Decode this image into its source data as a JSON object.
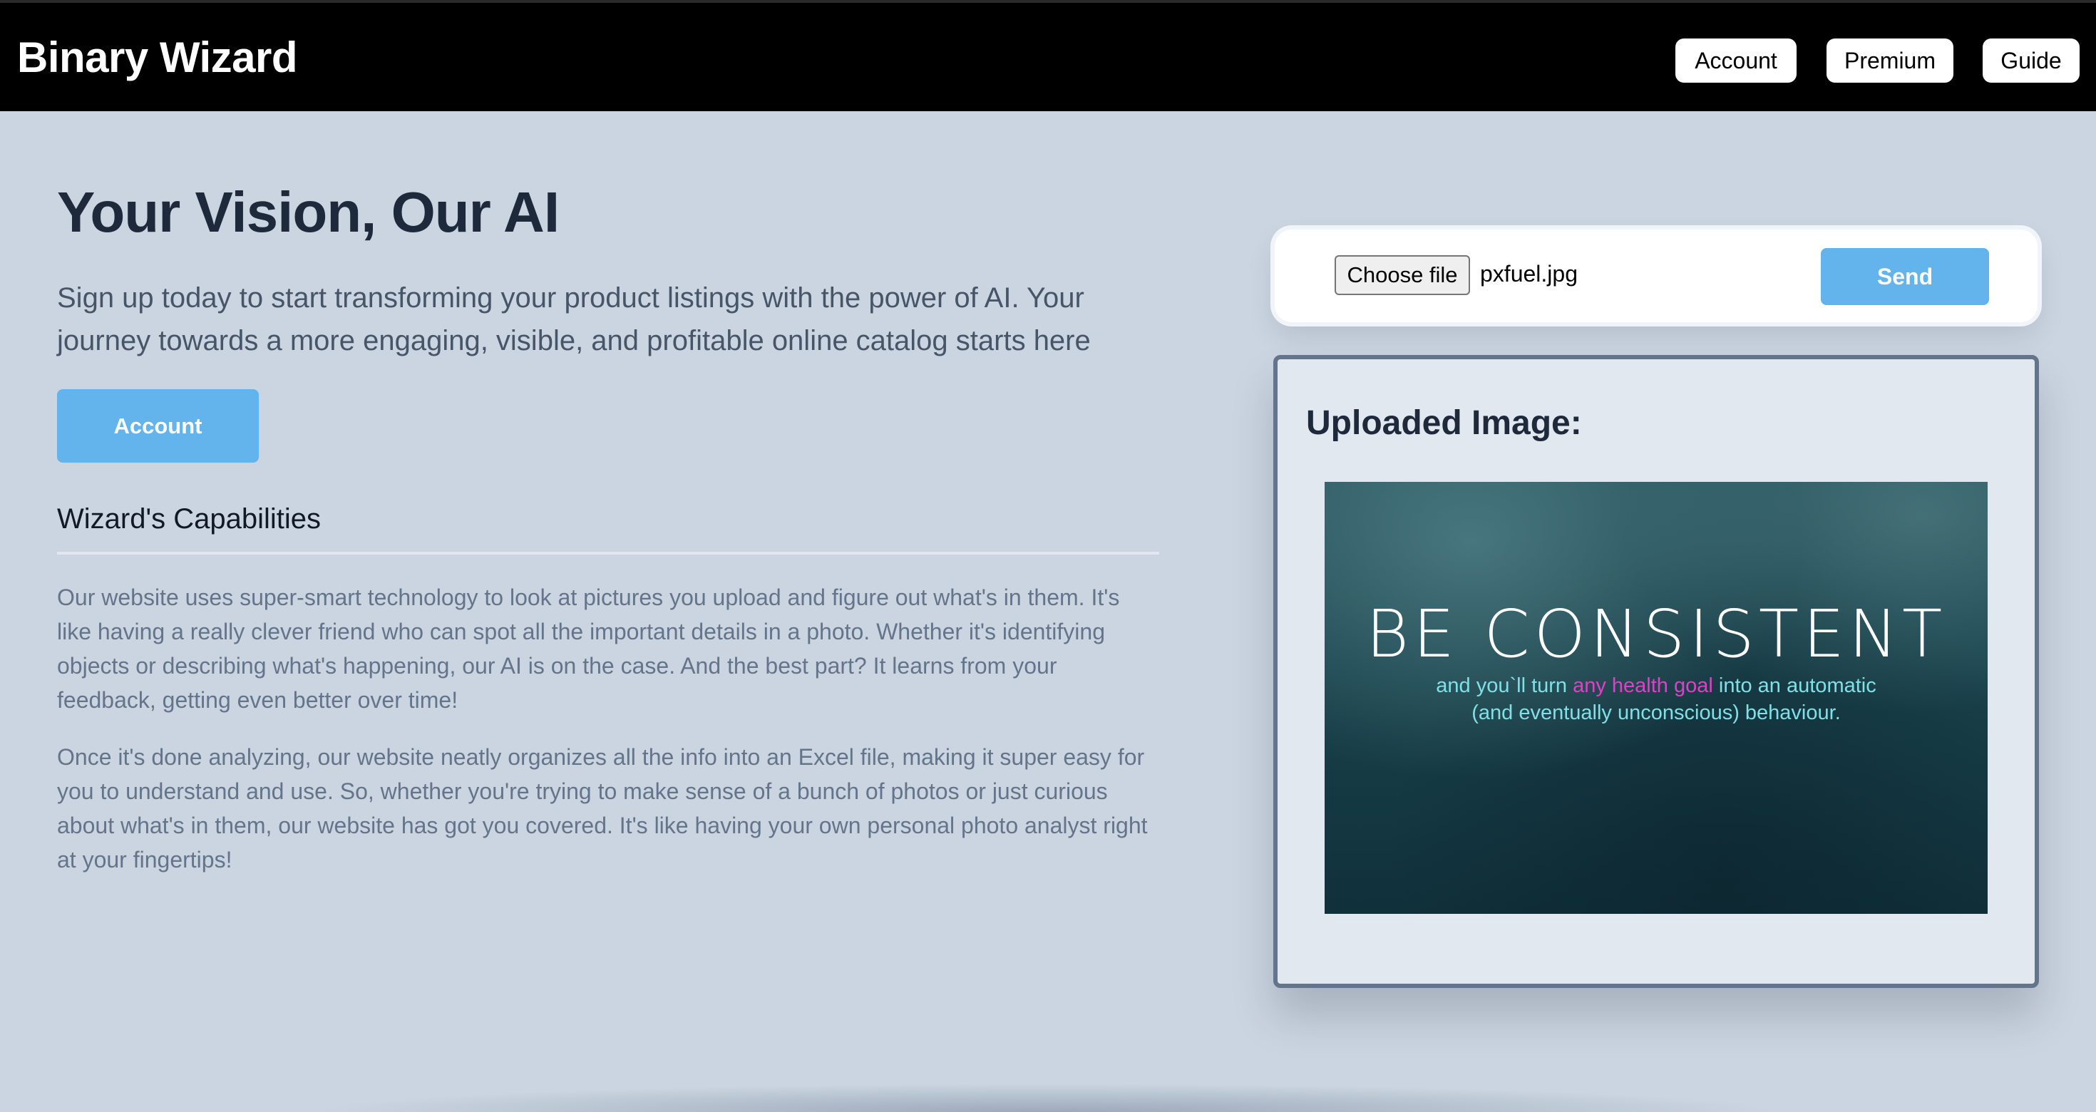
{
  "header": {
    "brand": "Binary Wizard",
    "nav": {
      "account": "Account",
      "premium": "Premium",
      "guide": "Guide"
    }
  },
  "hero": {
    "title": "Your Vision, Our AI",
    "subtitle": "Sign up today to start transforming your product listings with the power of AI. Your journey towards a more engaging, visible, and profitable online catalog starts here",
    "cta_label": "Account"
  },
  "capabilities": {
    "heading": "Wizard's Capabilities",
    "paragraph_1": "Our website uses super-smart technology to look at pictures you upload and figure out what's in them. It's like having a really clever friend who can spot all the important details in a photo. Whether it's identifying objects or describing what's happening, our AI is on the case. And the best part? It learns from your feedback, getting even better over time!",
    "paragraph_2": "Once it's done analyzing, our website neatly organizes all the info into an Excel file, making it super easy for you to understand and use. So, whether you're trying to make sense of a bunch of photos or just curious about what's in them, our website has got you covered. It's like having your own personal photo analyst right at your fingertips!"
  },
  "upload": {
    "choose_file_label": "Choose file",
    "file_name": "pxfuel.jpg",
    "send_label": "Send"
  },
  "preview": {
    "title": "Uploaded Image:",
    "image": {
      "headline": "BE CONSISTENT",
      "line1_pre": "and you`ll turn ",
      "line1_accent": "any health goal",
      "line1_post": " into an automatic",
      "line2": "(and eventually unconscious) behaviour."
    }
  },
  "colors": {
    "page_bg": "#cbd5e1",
    "header_bg": "#000000",
    "accent_button": "#63b3ed",
    "heading_text": "#1e293b",
    "body_text": "#64748b",
    "image_accent_pink": "#e040c8",
    "image_text_cyan": "#7fe0e6"
  }
}
